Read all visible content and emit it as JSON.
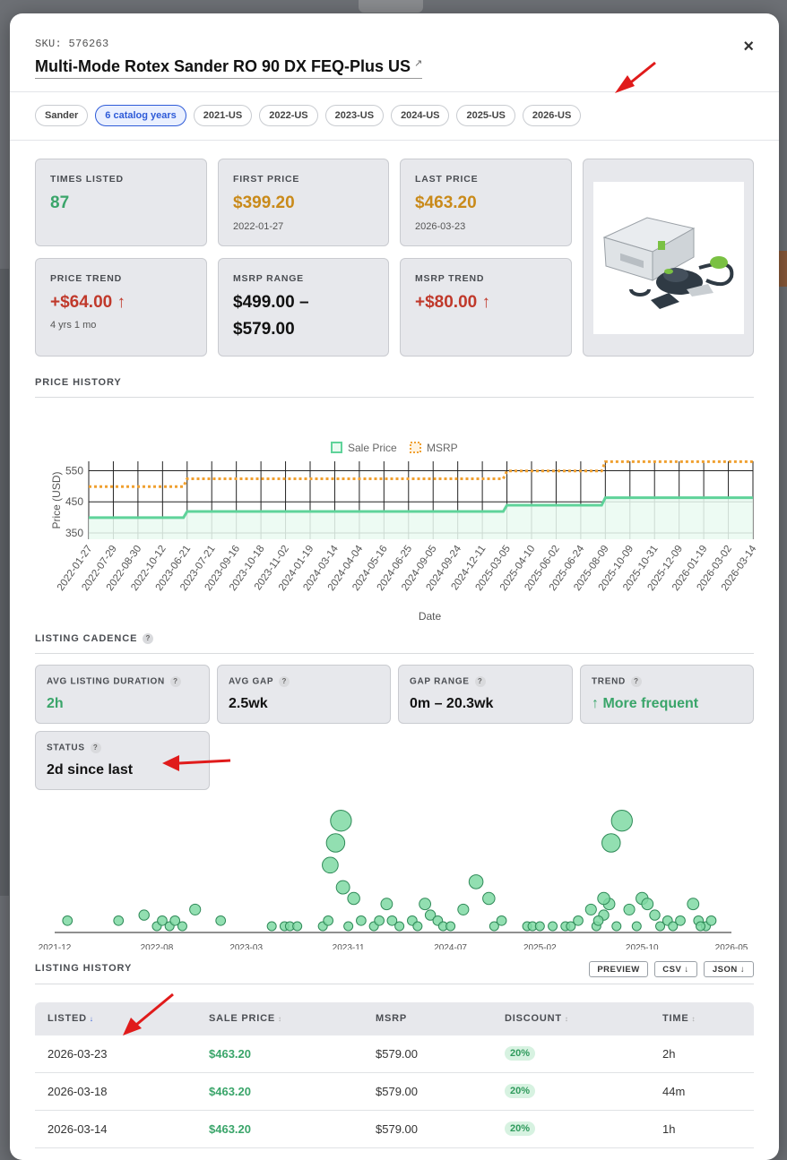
{
  "sku_label": "SKU: 576263",
  "title": "Multi-Mode Rotex Sander RO 90 DX FEQ-Plus US",
  "title_ext_icon": "external-link-icon",
  "close_icon": "×",
  "chips": [
    "Sander",
    "6 catalog years",
    "2021-US",
    "2022-US",
    "2023-US",
    "2024-US",
    "2025-US",
    "2026-US"
  ],
  "stats": {
    "times_listed": {
      "label": "TIMES LISTED",
      "value": "87"
    },
    "first_price": {
      "label": "FIRST PRICE",
      "value": "$399.20",
      "sub": "2022-01-27"
    },
    "last_price": {
      "label": "LAST PRICE",
      "value": "$463.20",
      "sub": "2026-03-23"
    },
    "price_trend": {
      "label": "PRICE TREND",
      "value": "+$64.00 ↑",
      "sub": "4 yrs 1 mo"
    },
    "msrp_range": {
      "label": "MSRP RANGE",
      "value_line1": "$499.00 –",
      "value_line2": "$579.00"
    },
    "msrp_trend": {
      "label": "MSRP TREND",
      "value": "+$80.00 ↑"
    }
  },
  "colors": {
    "green": "#3aa56a",
    "amber": "#c98a1a",
    "red": "#c0392b",
    "accent": "#2e5bd8",
    "msrp_line": "#f0a030",
    "sale_line": "#5fd39a"
  },
  "price_history": {
    "section_label": "PRICE HISTORY"
  },
  "chart_data": [
    {
      "type": "line",
      "title": "",
      "xlabel": "Date",
      "ylabel": "Price (USD)",
      "ylim": [
        330,
        580
      ],
      "yticks": [
        350,
        450,
        550
      ],
      "legend_position": "top-center",
      "x": [
        "2022-01-27",
        "2022-07-29",
        "2022-08-30",
        "2022-10-12",
        "2023-06-21",
        "2023-07-21",
        "2023-09-16",
        "2023-10-18",
        "2023-11-02",
        "2024-01-19",
        "2024-03-14",
        "2024-04-04",
        "2024-05-16",
        "2024-06-25",
        "2024-09-05",
        "2024-09-24",
        "2024-12-11",
        "2025-03-05",
        "2025-04-10",
        "2025-06-02",
        "2025-06-24",
        "2025-08-09",
        "2025-10-09",
        "2025-10-31",
        "2025-12-09",
        "2026-01-19",
        "2026-03-02",
        "2026-03-14"
      ],
      "series": [
        {
          "name": "Sale Price",
          "style": "solid",
          "values": [
            399.2,
            399.2,
            399.2,
            399.2,
            419.2,
            419.2,
            419.2,
            419.2,
            419.2,
            419.2,
            419.2,
            419.2,
            419.2,
            419.2,
            419.2,
            419.2,
            419.2,
            439.2,
            439.2,
            439.2,
            439.2,
            463.2,
            463.2,
            463.2,
            463.2,
            463.2,
            463.2,
            463.2
          ]
        },
        {
          "name": "MSRP",
          "style": "dotted",
          "values": [
            499,
            499,
            499,
            499,
            524,
            524,
            524,
            524,
            524,
            524,
            524,
            524,
            524,
            524,
            524,
            524,
            524,
            549,
            549,
            549,
            549,
            579,
            579,
            579,
            579,
            579,
            579,
            579
          ]
        }
      ]
    },
    {
      "type": "scatter",
      "title": "",
      "x_ticks": [
        "2021-12",
        "2022-08",
        "2023-03",
        "2023-11",
        "2024-07",
        "2025-02",
        "2025-10",
        "2026-05"
      ],
      "y_meaning": "gap to next listing (bubble height & size)",
      "points": [
        {
          "x": "2022-01",
          "y": 1
        },
        {
          "x": "2022-05",
          "y": 1
        },
        {
          "x": "2022-07",
          "y": 2
        },
        {
          "x": "2022-08",
          "y": 0
        },
        {
          "x": "2022-08",
          "y": 1
        },
        {
          "x": "2022-09",
          "y": 0
        },
        {
          "x": "2022-09",
          "y": 1
        },
        {
          "x": "2022-10",
          "y": 0
        },
        {
          "x": "2022-11",
          "y": 3
        },
        {
          "x": "2023-01",
          "y": 1
        },
        {
          "x": "2023-05",
          "y": 0
        },
        {
          "x": "2023-06",
          "y": 0
        },
        {
          "x": "2023-06",
          "y": 0
        },
        {
          "x": "2023-07",
          "y": 0
        },
        {
          "x": "2023-09",
          "y": 0
        },
        {
          "x": "2023-09",
          "y": 1
        },
        {
          "x": "2023-10",
          "y": 15
        },
        {
          "x": "2023-10",
          "y": 19
        },
        {
          "x": "2023-10",
          "y": 11
        },
        {
          "x": "2023-11",
          "y": 0
        },
        {
          "x": "2023-11",
          "y": 5
        },
        {
          "x": "2023-11",
          "y": 7
        },
        {
          "x": "2023-12",
          "y": 1
        },
        {
          "x": "2024-01",
          "y": 0
        },
        {
          "x": "2024-01",
          "y": 1
        },
        {
          "x": "2024-02",
          "y": 4
        },
        {
          "x": "2024-02",
          "y": 1
        },
        {
          "x": "2024-03",
          "y": 0
        },
        {
          "x": "2024-04",
          "y": 1
        },
        {
          "x": "2024-04",
          "y": 0
        },
        {
          "x": "2024-05",
          "y": 4
        },
        {
          "x": "2024-05",
          "y": 2
        },
        {
          "x": "2024-06",
          "y": 1
        },
        {
          "x": "2024-06",
          "y": 0
        },
        {
          "x": "2024-07",
          "y": 0
        },
        {
          "x": "2024-08",
          "y": 3
        },
        {
          "x": "2024-09",
          "y": 8
        },
        {
          "x": "2024-10",
          "y": 5
        },
        {
          "x": "2024-10",
          "y": 0
        },
        {
          "x": "2024-11",
          "y": 1
        },
        {
          "x": "2025-01",
          "y": 0
        },
        {
          "x": "2025-01",
          "y": 0
        },
        {
          "x": "2025-02",
          "y": 0
        },
        {
          "x": "2025-03",
          "y": 0
        },
        {
          "x": "2025-04",
          "y": 0
        },
        {
          "x": "2025-04",
          "y": 0
        },
        {
          "x": "2025-05",
          "y": 1
        },
        {
          "x": "2025-06",
          "y": 3
        },
        {
          "x": "2025-06",
          "y": 0
        },
        {
          "x": "2025-07",
          "y": 2
        },
        {
          "x": "2025-07",
          "y": 4
        },
        {
          "x": "2025-07",
          "y": 1
        },
        {
          "x": "2025-07",
          "y": 5
        },
        {
          "x": "2025-08",
          "y": 0
        },
        {
          "x": "2025-09",
          "y": 3
        },
        {
          "x": "2025-08",
          "y": 19
        },
        {
          "x": "2025-08",
          "y": 15
        },
        {
          "x": "2025-10",
          "y": 5
        },
        {
          "x": "2025-10",
          "y": 4
        },
        {
          "x": "2025-10",
          "y": 0
        },
        {
          "x": "2025-11",
          "y": 2
        },
        {
          "x": "2025-11",
          "y": 0
        },
        {
          "x": "2025-12",
          "y": 1
        },
        {
          "x": "2025-12",
          "y": 0
        },
        {
          "x": "2026-01",
          "y": 1
        },
        {
          "x": "2026-02",
          "y": 4
        },
        {
          "x": "2026-02",
          "y": 1
        },
        {
          "x": "2026-03",
          "y": 0
        },
        {
          "x": "2026-03",
          "y": 1
        },
        {
          "x": "2026-03",
          "y": 0
        }
      ]
    }
  ],
  "cadence": {
    "section_label": "LISTING CADENCE",
    "cards": [
      {
        "label": "AVG LISTING DURATION",
        "value": "2h",
        "tone": "green"
      },
      {
        "label": "AVG GAP",
        "value": "2.5wk",
        "tone": "dark"
      },
      {
        "label": "GAP RANGE",
        "value": "0m – 20.3wk",
        "tone": "dark"
      },
      {
        "label": "TREND",
        "value": "↑ More frequent",
        "tone": "green"
      },
      {
        "label": "STATUS",
        "value": "2d since last",
        "tone": "dark"
      }
    ]
  },
  "listing_history": {
    "section_label": "LISTING HISTORY",
    "buttons": {
      "preview": "PREVIEW",
      "csv": "CSV ↓",
      "json": "JSON ↓"
    },
    "columns": [
      {
        "label": "LISTED",
        "sort": "↓",
        "active": true
      },
      {
        "label": "SALE PRICE",
        "sort": "↕",
        "active": false
      },
      {
        "label": "MSRP",
        "sort": "",
        "active": false
      },
      {
        "label": "DISCOUNT",
        "sort": "↕",
        "active": false
      },
      {
        "label": "TIME",
        "sort": "↕",
        "active": false
      }
    ],
    "rows": [
      {
        "listed": "2026-03-23",
        "sale": "$463.20",
        "msrp": "$579.00",
        "discount": "20%",
        "time": "2h"
      },
      {
        "listed": "2026-03-18",
        "sale": "$463.20",
        "msrp": "$579.00",
        "discount": "20%",
        "time": "44m"
      },
      {
        "listed": "2026-03-14",
        "sale": "$463.20",
        "msrp": "$579.00",
        "discount": "20%",
        "time": "1h"
      }
    ]
  }
}
